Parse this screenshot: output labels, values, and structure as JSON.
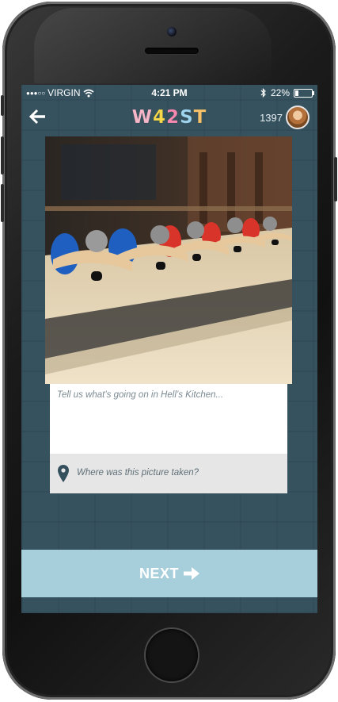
{
  "status_bar": {
    "signal": "●●●○○",
    "carrier": "VIRGIN",
    "wifi_icon": "wifi-icon",
    "time": "4:21 PM",
    "bluetooth_icon": "bluetooth-icon",
    "battery": "22%",
    "battery_level": 0.22
  },
  "header": {
    "back_icon": "back-arrow-icon",
    "logo": {
      "chars": [
        "W",
        "4",
        "2",
        "S",
        "T"
      ],
      "colors": [
        "#f5b6c8",
        "#f7d84a",
        "#f58ab1",
        "#9fd4ee",
        "#f5c16a"
      ]
    },
    "points": "1397",
    "avatar": "user-avatar"
  },
  "post": {
    "photo": "photo of toy wooden cars on a windowsill",
    "caption_placeholder": "Tell us what’s going on in Hell’s Kitchen...",
    "location_placeholder": "Where was this picture taken?",
    "location_icon": "map-pin-icon"
  },
  "footer": {
    "next_label": "NEXT",
    "next_icon": "arrow-right-icon"
  },
  "colors": {
    "screen_bg": "#36525f",
    "next_bar": "#a7cedb",
    "location_bg": "#e6e6e6"
  }
}
